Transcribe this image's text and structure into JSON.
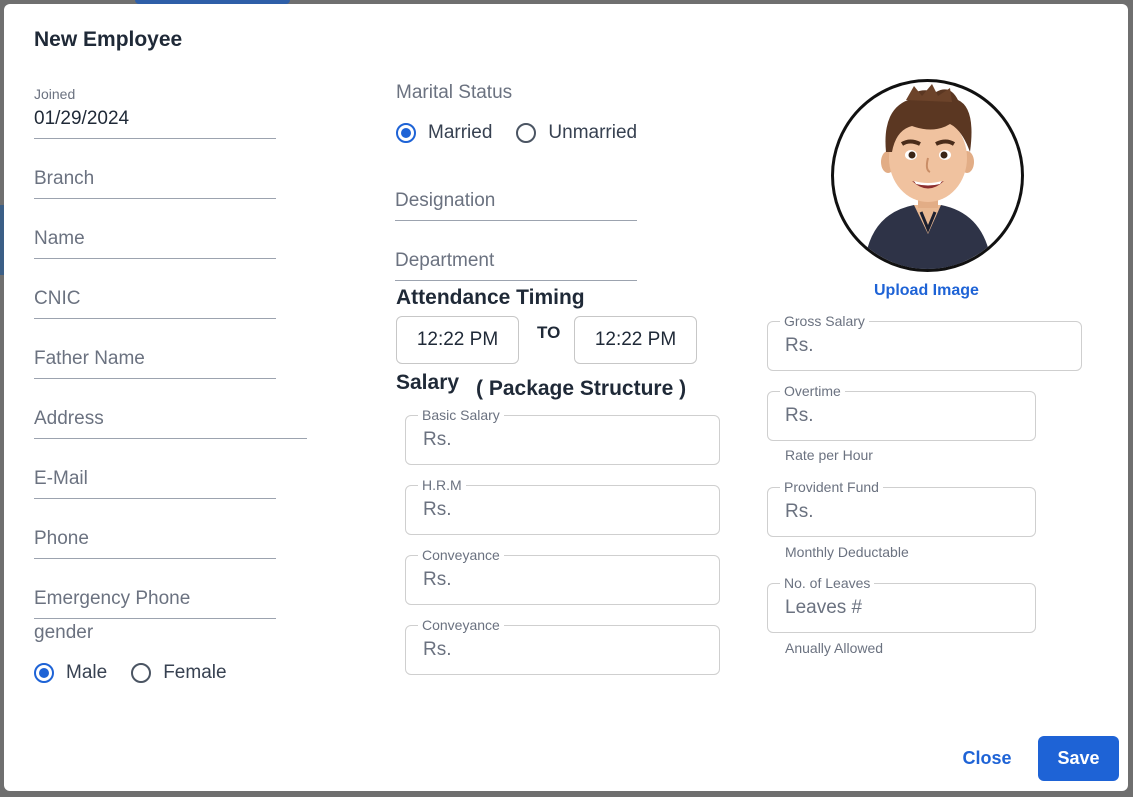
{
  "dialog": {
    "title": "New Employee"
  },
  "left_fields": {
    "joined": {
      "label": "Joined",
      "value": "01/29/2024"
    },
    "branch": "Branch",
    "name": "Name",
    "cnic": "CNIC",
    "father_name": "Father Name",
    "address": "Address",
    "email": "E-Mail",
    "phone": "Phone",
    "emergency_phone": "Emergency Phone"
  },
  "gender": {
    "label": "gender",
    "options": [
      "Male",
      "Female"
    ],
    "selected": "Male"
  },
  "marital": {
    "label": "Marital Status",
    "options": [
      "Married",
      "Unmarried"
    ],
    "selected": "Married"
  },
  "designation": "Designation",
  "department": "Department",
  "attendance": {
    "heading": "Attendance Timing",
    "from": "12:22 PM",
    "to_label": "TO",
    "to": "12:22 PM"
  },
  "salary": {
    "heading": "Salary",
    "subheading": "( Package Structure )",
    "basic": {
      "label": "Basic Salary",
      "placeholder": "Rs."
    },
    "hrm": {
      "label": "H.R.M",
      "placeholder": "Rs."
    },
    "conveyance1": {
      "label": "Conveyance",
      "placeholder": "Rs."
    },
    "conveyance2": {
      "label": "Conveyance",
      "placeholder": "Rs."
    }
  },
  "right": {
    "upload_label": "Upload Image",
    "gross": {
      "label": "Gross Salary",
      "placeholder": "Rs."
    },
    "overtime": {
      "label": "Overtime",
      "placeholder": "Rs.",
      "helper": "Rate per Hour"
    },
    "provident": {
      "label": "Provident Fund",
      "placeholder": "Rs.",
      "helper": "Monthly Deductable"
    },
    "leaves": {
      "label": "No. of Leaves",
      "placeholder": "Leaves #",
      "helper": "Anually Allowed"
    }
  },
  "actions": {
    "close": "Close",
    "save": "Save"
  },
  "colors": {
    "accent": "#1e63d6",
    "text": "#1f2937",
    "muted": "#6b7280"
  }
}
